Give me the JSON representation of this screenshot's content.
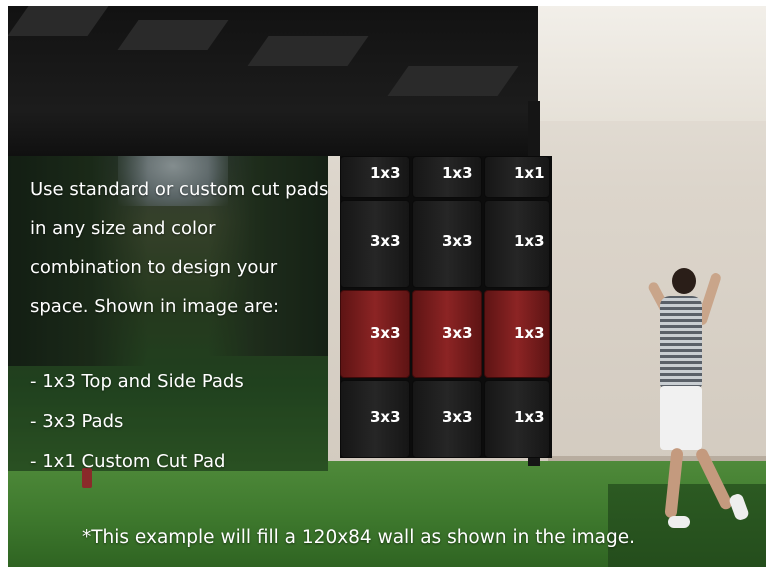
{
  "intro": "Use standard or custom cut pads in any size and color combination to design your space. Shown in image are:",
  "bullets": [
    "- 1x3 Top and Side Pads",
    "- 3x3 Pads",
    "- 1x1 Custom Cut Pad"
  ],
  "footnote": "*This example will fill a 120x84 wall as shown in the image.",
  "pad_grid": {
    "rows": [
      [
        "1x3",
        "1x3",
        "1x1"
      ],
      [
        "3x3",
        "3x3",
        "1x3"
      ],
      [
        "3x3",
        "3x3",
        "1x3"
      ],
      [
        "3x3",
        "3x3",
        "1x3"
      ]
    ],
    "colors": {
      "black": "#1e1e1e",
      "red": "#8c2424"
    },
    "highlight_row": 2
  },
  "colors": {
    "text": "#ffffff",
    "turf": "#3f7a2e",
    "wall": "#dcd5cb",
    "enclosure": "#141414"
  }
}
